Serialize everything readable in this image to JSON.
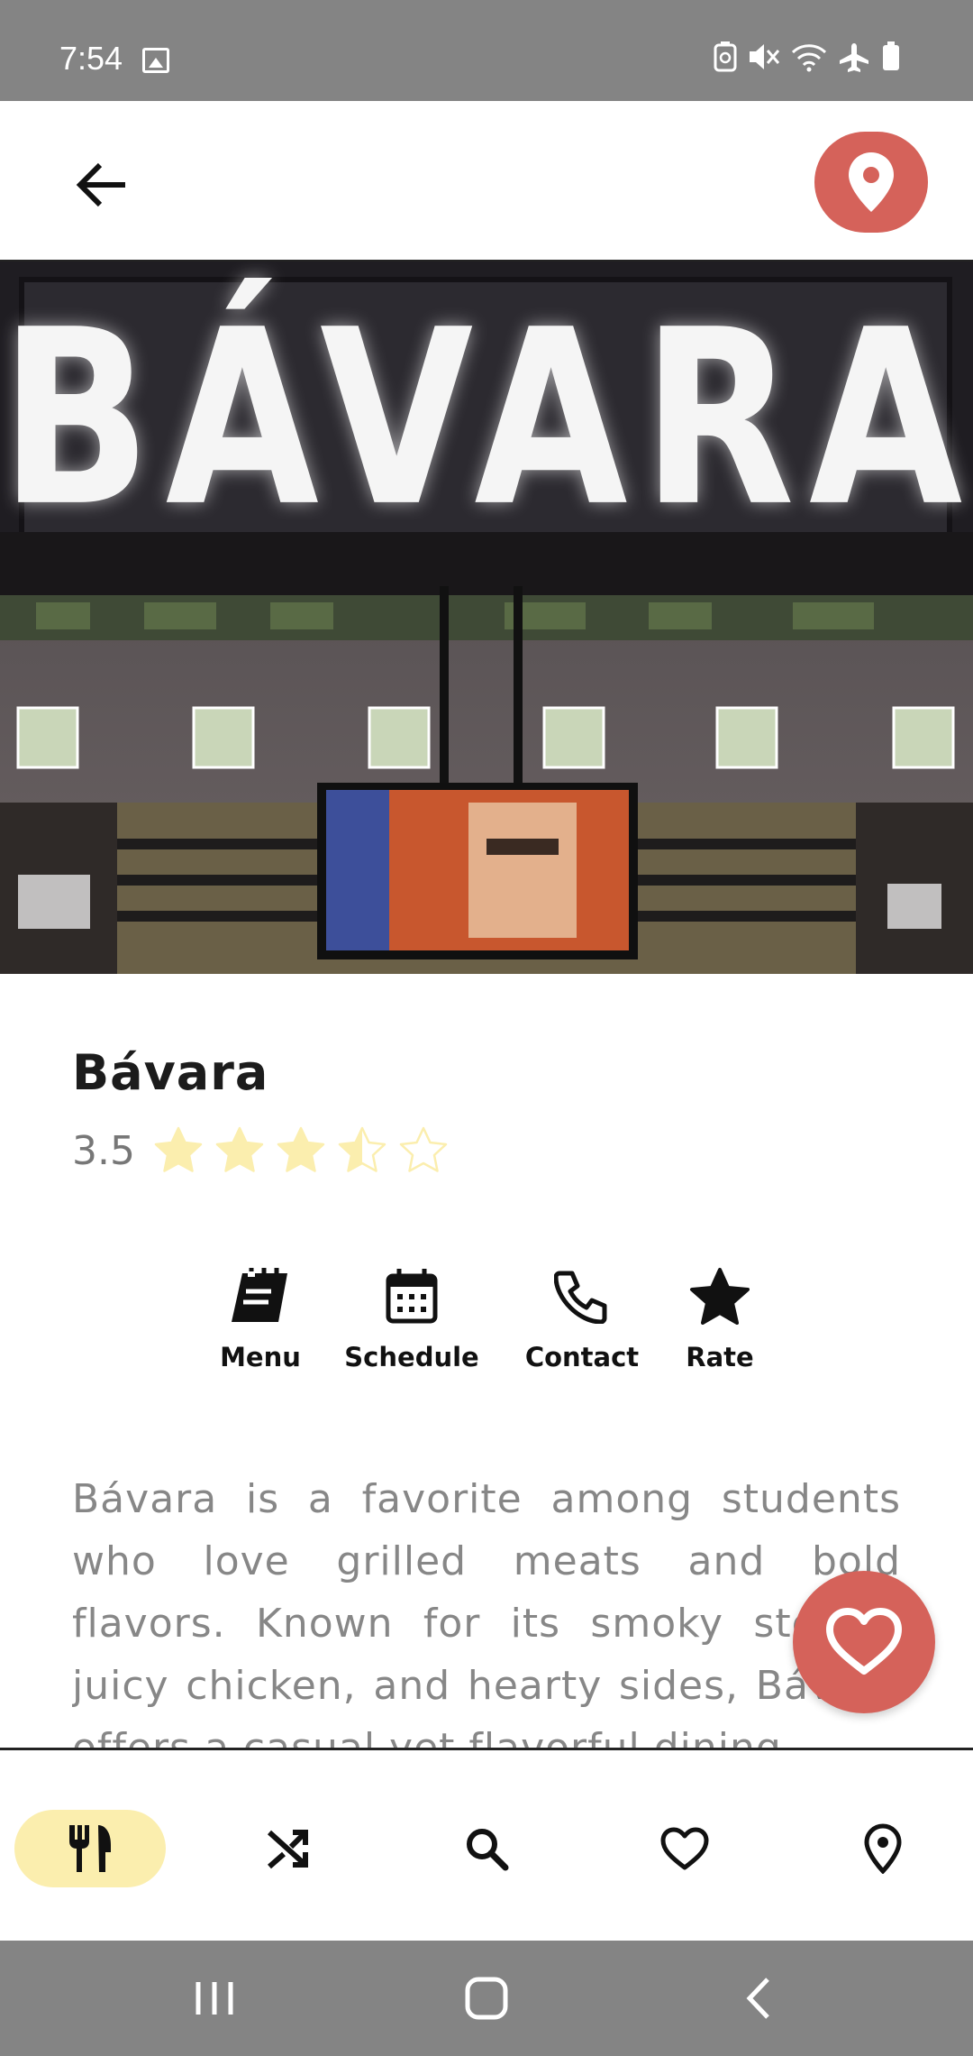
{
  "status_bar": {
    "time": "7:54",
    "icons": [
      "image-icon",
      "battery-saver-icon",
      "mute-icon",
      "wifi-icon",
      "airplane-icon",
      "battery-icon"
    ]
  },
  "app_bar": {
    "back_icon": "arrow-left-icon",
    "map_icon": "location-pin-icon",
    "accent_color": "#d5625a"
  },
  "hero": {
    "sign_text": "BÁVARA"
  },
  "restaurant": {
    "name": "Bávara",
    "rating": "3.5",
    "rating_value": 3.5,
    "rating_max": 5,
    "star_color": "#fbeeae"
  },
  "actions": [
    {
      "label": "Menu",
      "icon": "menu-book-icon"
    },
    {
      "label": "Schedule",
      "icon": "calendar-icon"
    },
    {
      "label": "Contact",
      "icon": "phone-icon"
    },
    {
      "label": "Rate",
      "icon": "star-icon"
    }
  ],
  "description": "Bávara is a favorite among students who love grilled meats and bold flavors. Known for its smoky steaks, juicy chicken, and hearty sides, Bávara offers a casual yet flavorful dining",
  "favorite_fab": {
    "icon": "heart-outline-icon"
  },
  "bottom_nav": {
    "items": [
      {
        "icon": "restaurant-icon",
        "active": true,
        "highlight_color": "#fbeeae"
      },
      {
        "icon": "shuffle-icon",
        "active": false
      },
      {
        "icon": "search-icon",
        "active": false
      },
      {
        "icon": "heart-outline-icon",
        "active": false
      },
      {
        "icon": "location-pin-outline-icon",
        "active": false
      }
    ]
  },
  "system_nav": {
    "icons": [
      "recents-icon",
      "home-icon",
      "back-chevron-icon"
    ]
  }
}
